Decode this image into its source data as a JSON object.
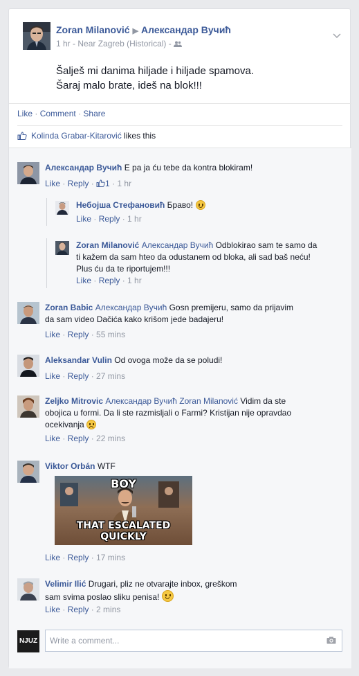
{
  "post": {
    "author": "Zoran Milanović",
    "target": "Александар Вучић",
    "time": "1 hr",
    "location": "Near Zagreb (Historical)",
    "privacy_sep": "·",
    "line1": "Šalješ mi danima hiljade i hiljade spamova.",
    "line2": "Šaraj malo brate, ideš na blok!!!"
  },
  "actions": {
    "like": "Like",
    "comment": "Comment",
    "share": "Share",
    "dot": "·"
  },
  "likes": {
    "name": "Kolinda Grabar-Kitarović",
    "suffix": "likes this"
  },
  "comments": [
    {
      "author": "Александар Вучић",
      "text": "E pa ja ću tebe da kontra blokiram!",
      "like": "Like",
      "reply": "Reply",
      "likes_count": "1",
      "time": "1 hr"
    },
    {
      "author": "Небојша Стефановић",
      "text": "Браво!",
      "like": "Like",
      "reply": "Reply",
      "time": "1 hr"
    },
    {
      "author": "Zoran Milanović",
      "tag": "Александар Вучић",
      "text1": "Odblokirao sam te samo da",
      "text2": "ti kažem da sam hteo da odustanem od bloka, ali sad baš neću!",
      "text3": "Plus ću da te riportujem!!!",
      "like": "Like",
      "reply": "Reply",
      "time": "1 hr"
    },
    {
      "author": "Zoran Babic",
      "tag": "Александар Вучић",
      "text1": "Gosn premijeru, samo da prijavim",
      "text2": "da sam video Dačića kako krišom jede badajeru!",
      "like": "Like",
      "reply": "Reply",
      "time": "55 mins"
    },
    {
      "author": "Aleksandar Vulin",
      "text": "Od ovoga može da se poludi!",
      "like": "Like",
      "reply": "Reply",
      "time": "27 mins"
    },
    {
      "author": "Zeljko Mitrovic",
      "tag1": "Александар Вучић",
      "tag2": "Zoran Milanović",
      "text1": "Vidim da ste",
      "text2": "obojica u formi. Da li ste razmisljali o Farmi? Kristijan nije opravdao",
      "text3": "ocekivanja",
      "like": "Like",
      "reply": "Reply",
      "time": "22 mins"
    },
    {
      "author": "Viktor Orbán",
      "text": "WTF",
      "meme_top": "BOY",
      "meme_bottom": "THAT ESCALATED QUICKLY",
      "like": "Like",
      "reply": "Reply",
      "time": "17 mins"
    },
    {
      "author": "Velimir Ilić",
      "text1": "Drugari, pliz ne otvarajte inbox, greškom",
      "text2": "sam svima poslao sliku penisa!",
      "like": "Like",
      "reply": "Reply",
      "time": "2 mins"
    }
  ],
  "composer": {
    "placeholder": "Write a comment...",
    "avatar_text": "NJUZ"
  },
  "colors": {
    "link": "#3b5998",
    "muted": "#9197a3",
    "bg": "#e9eaed"
  }
}
